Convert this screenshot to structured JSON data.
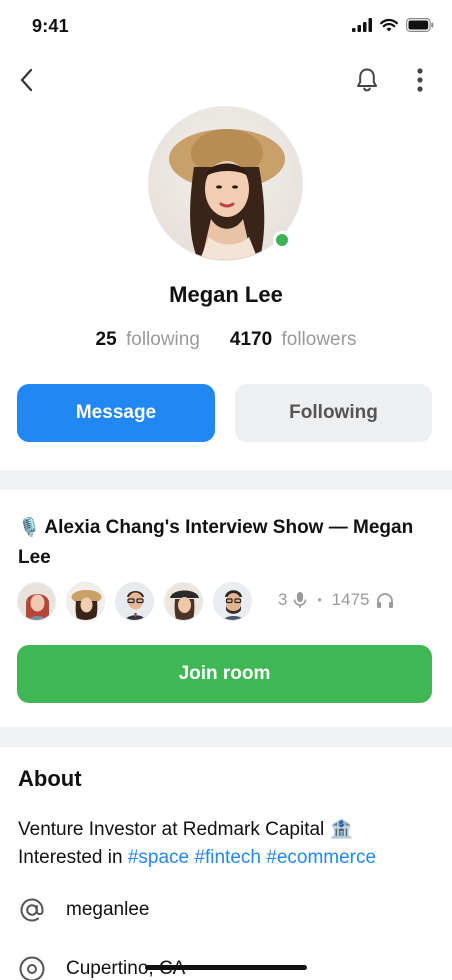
{
  "status_bar": {
    "time": "9:41"
  },
  "profile": {
    "name": "Megan Lee",
    "following_count": "25",
    "following_label": "following",
    "followers_count": "4170",
    "followers_label": "followers",
    "online": true
  },
  "actions": {
    "message_label": "Message",
    "following_label": "Following"
  },
  "room": {
    "title": "Alexia Chang's Interview Show — Megan Lee",
    "speaker_count": "3",
    "listener_count": "1475",
    "separator": "•",
    "join_label": "Join room"
  },
  "about": {
    "heading": "About",
    "bio_line1": "Venture Investor at Redmark Capital 🏦",
    "bio_line2_prefix": "Interested in",
    "hashtags": [
      "#space",
      "#fintech",
      "#ecommerce"
    ],
    "username": "meganlee",
    "location": "Cupertino, CA"
  },
  "colors": {
    "accent_blue": "#2187f2",
    "join_green": "#3fb755",
    "online_green": "#3cb454",
    "muted_text": "#9a9a9a",
    "secondary_button_bg": "#eeeff1"
  },
  "icons": {
    "back": "chevron-left-icon",
    "bell": "bell-icon",
    "more": "more-vertical-icon",
    "mic": "microphone-icon",
    "headphones": "headphones-icon",
    "at": "at-sign-icon",
    "location": "location-pin-icon"
  }
}
